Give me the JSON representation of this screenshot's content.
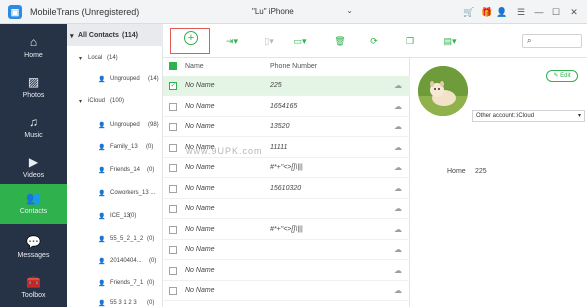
{
  "app": {
    "logo_glyph": "▣",
    "title": "MobileTrans (Unregistered)"
  },
  "device": {
    "name": "\"Lu\" iPhone"
  },
  "titlebar_icons": [
    "cart-icon",
    "gift-icon",
    "user-icon",
    "menu-icon",
    "minimize-icon",
    "maximize-icon",
    "close-icon"
  ],
  "nav": {
    "items": [
      {
        "label": "Home",
        "icon": "home-icon"
      },
      {
        "label": "Photos",
        "icon": "photos-icon"
      },
      {
        "label": "Music",
        "icon": "music-icon"
      },
      {
        "label": "Videos",
        "icon": "videos-icon"
      },
      {
        "label": "Contacts",
        "icon": "contacts-icon",
        "active": true
      },
      {
        "label": "Messages",
        "icon": "messages-icon"
      },
      {
        "label": "Toolbox",
        "icon": "toolbox-icon"
      }
    ]
  },
  "tree": {
    "all": {
      "label": "All Contacts",
      "count": "(114)"
    },
    "rows": [
      {
        "label": "Local",
        "count": "(14)"
      },
      {
        "label": "Ungrouped",
        "count": "(14)"
      },
      {
        "label": "iCloud",
        "count": "(100)"
      },
      {
        "label": "Ungrouped",
        "count": "(98)"
      },
      {
        "label": "Family_13",
        "count": "(0)"
      },
      {
        "label": "Friends_14",
        "count": "(0)"
      },
      {
        "label": "Coworkers_13 ...",
        "count": ""
      },
      {
        "label": "ICE_13",
        "count": "(0)"
      },
      {
        "label": "55_5_2_1_2",
        "count": "(0)"
      },
      {
        "label": "20140404... ",
        "count": "(0)"
      },
      {
        "label": "Friends_7_1",
        "count": "(0)"
      },
      {
        "label": "55 3 1 2 3",
        "count": "(0)"
      }
    ]
  },
  "toolbar": {
    "add_label": "+",
    "tools": [
      "import-icon",
      "export-icon",
      "transfer-icon",
      "delete-icon",
      "refresh-icon",
      "duplicate-icon",
      "toolbox-icon"
    ],
    "search_glyph": "⌕"
  },
  "table": {
    "col_name": "Name",
    "col_phone": "Phone Number",
    "rows": [
      {
        "name": "No Name",
        "phone": "225",
        "selected": true,
        "sync_icon": "☁"
      },
      {
        "name": "No Name",
        "phone": "1654165",
        "selected": false,
        "sync_icon": "☁"
      },
      {
        "name": "No Name",
        "phone": "13520",
        "selected": false,
        "sync_icon": "☁"
      },
      {
        "name": "No Name",
        "phone": "11111",
        "selected": false,
        "sync_icon": "☁"
      },
      {
        "name": "No Name",
        "phone": "#*+\"<>[]\\|||",
        "selected": false,
        "sync_icon": "☁"
      },
      {
        "name": "No Name",
        "phone": "15610320",
        "selected": false,
        "sync_icon": "☁"
      },
      {
        "name": "No Name",
        "phone": "",
        "selected": false,
        "sync_icon": "☁"
      },
      {
        "name": "No Name",
        "phone": "#*+\"<>[]\\|||",
        "selected": false,
        "sync_icon": "☁"
      },
      {
        "name": "No Name",
        "phone": "",
        "selected": false,
        "sync_icon": "☁"
      },
      {
        "name": "No Name",
        "phone": "",
        "selected": false,
        "sync_icon": "☁"
      },
      {
        "name": "No Name",
        "phone": "",
        "selected": false,
        "sync_icon": "☁"
      }
    ]
  },
  "detail": {
    "edit_label": "Edit",
    "account": "Other account::iCloud",
    "field_label": "Home",
    "field_value": "225"
  },
  "watermark": "www.9UPK.com",
  "colors": {
    "nav_bg": "#263245",
    "accent": "#2fb14d",
    "selected_row": "#e4f5e6",
    "highlight_box": "#e35a5a"
  }
}
